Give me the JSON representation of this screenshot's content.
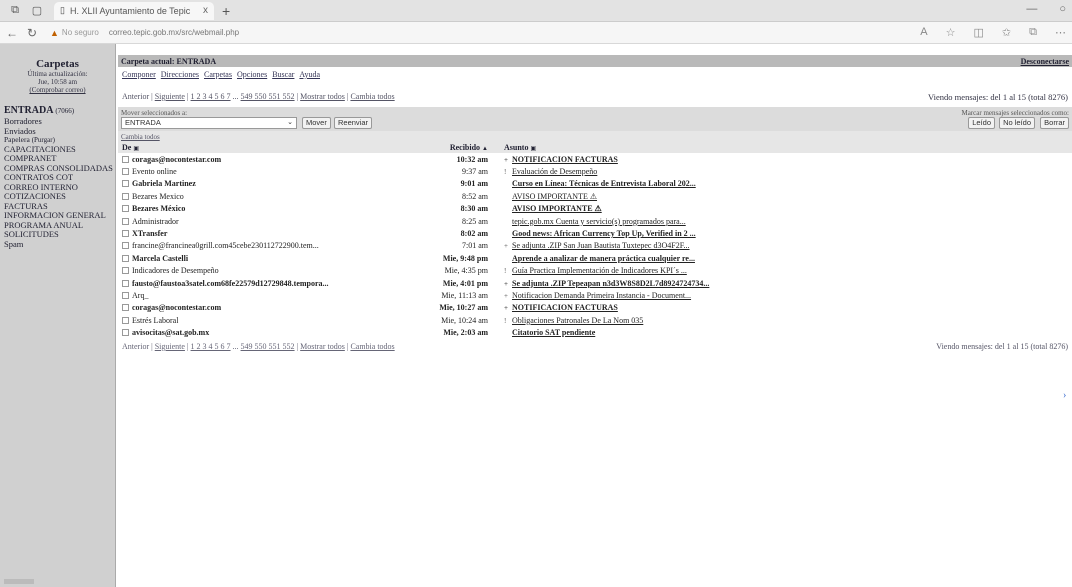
{
  "browser": {
    "tab_title": "H. XLII Ayuntamiento de Tepic",
    "tab_close": "x",
    "new_tab": "+",
    "not_secure": "No seguro",
    "url": "correo.tepic.gob.mx/src/webmail.php"
  },
  "sidebar": {
    "title": "Carpetas",
    "last_update_label": "Última actualización:",
    "last_update_time": "Jue, 10:58 am",
    "check_mail": "(Comprobar correo)",
    "folders": [
      {
        "name": "ENTRADA",
        "count": "(7066)",
        "style": "big"
      },
      {
        "name": "Borradores",
        "count": "",
        "style": ""
      },
      {
        "name": "Enviados",
        "count": "",
        "style": ""
      },
      {
        "name": "Papelera",
        "count": "(Purgar)",
        "style": "small"
      },
      {
        "name": "CAPACITACIONES",
        "count": "",
        "style": ""
      },
      {
        "name": "COMPRANET",
        "count": "",
        "style": ""
      },
      {
        "name": "COMPRAS CONSOLIDADAS",
        "count": "",
        "style": ""
      },
      {
        "name": "CONTRATOS COT",
        "count": "",
        "style": ""
      },
      {
        "name": "CORREO INTERNO",
        "count": "",
        "style": ""
      },
      {
        "name": "COTIZACIONES",
        "count": "",
        "style": ""
      },
      {
        "name": "FACTURAS",
        "count": "",
        "style": ""
      },
      {
        "name": "INFORMACION GENERAL",
        "count": "",
        "style": ""
      },
      {
        "name": "PROGRAMA ANUAL",
        "count": "",
        "style": ""
      },
      {
        "name": "SOLICITUDES",
        "count": "",
        "style": ""
      },
      {
        "name": "Spam",
        "count": "",
        "style": ""
      }
    ]
  },
  "header": {
    "current_folder_label": "Carpeta actual:",
    "current_folder": "ENTRADA",
    "disconnect": "Desconectarse"
  },
  "menu": [
    "Componer",
    "Direcciones",
    "Carpetas",
    "Opciones",
    "Buscar",
    "Ayuda"
  ],
  "pager": {
    "prev": "Anterior",
    "next": "Siguiente",
    "pages": "1 2 3 4 5 6 7",
    "ellipsis": "...",
    "far_pages": "549 550 551 552",
    "show_all": "Mostrar todos",
    "toggle_all": "Cambia todos",
    "viewing": "Viendo mensajes: del 1 al 15 (total 8276)"
  },
  "move": {
    "label": "Mover seleccionados a:",
    "folder": "ENTRADA",
    "move_button": "Mover",
    "forward_button": "Reenviar",
    "mark_label": "Marcar mensajes seleccionados como:",
    "read_button": "Leído",
    "unread_button": "No leído",
    "delete_button": "Borrar",
    "toggle": "Cambia todos"
  },
  "columns": {
    "from": "De",
    "received": "Recibido",
    "subject": "Asunto"
  },
  "messages": [
    {
      "from": "coragas@nocontestar.com",
      "received": "10:32 am",
      "flag": "+",
      "subject": "NOTIFICACION FACTURAS",
      "unread": true
    },
    {
      "from": "Evento online",
      "received": "9:37 am",
      "flag": "!",
      "subject": "Evaluación de Desempeño",
      "unread": false
    },
    {
      "from": "Gabriela Martinez",
      "received": "9:01 am",
      "flag": "",
      "subject": "Curso en Línea: Técnicas de Entrevista Laboral 202...",
      "unread": true
    },
    {
      "from": "Bezares Mexico",
      "received": "8:52 am",
      "flag": "",
      "subject": "AVISO IMPORTANTE ⚠",
      "unread": false
    },
    {
      "from": "Bezares México",
      "received": "8:30 am",
      "flag": "",
      "subject": "AVISO IMPORTANTE ⚠",
      "unread": true
    },
    {
      "from": "Administrador",
      "received": "8:25 am",
      "flag": "",
      "subject": "tepic.gob.mx Cuenta y servicio(s) programados para...",
      "unread": false
    },
    {
      "from": "XTransfer",
      "received": "8:02 am",
      "flag": "",
      "subject": "Good news: African Currency Top Up, Verified in 2 ...",
      "unread": true
    },
    {
      "from": "francine@francinea0grill.com45cebe230112722900.tem...",
      "received": "7:01 am",
      "flag": "+",
      "subject": "Se adjunta .ZIP San Juan Bautista Tuxtepec d3O4F2F...",
      "unread": false
    },
    {
      "from": "Marcela Castelli",
      "received": "Mie, 9:48 pm",
      "flag": "",
      "subject": "Aprende a analizar de manera práctica cualquier re...",
      "unread": true
    },
    {
      "from": "Indicadores de Desempeño",
      "received": "Mie, 4:35 pm",
      "flag": "!",
      "subject": "Guía Practica Implementación de Indicadores KPI´s ...",
      "unread": false
    },
    {
      "from": "fausto@faustoa3satel.com68fe22579d12729848.tempora...",
      "received": "Mie, 4:01 pm",
      "flag": "+",
      "subject": "Se adjunta .ZIP Tepeapan n3d3W8S8D2L7d8924724734...",
      "unread": true
    },
    {
      "from": "Arq_",
      "received": "Mie, 11:13 am",
      "flag": "+",
      "subject": "Notificacion Demanda Primeira Instancia - Document...",
      "unread": false
    },
    {
      "from": "coragas@nocontestar.com",
      "received": "Mie, 10:27 am",
      "flag": "+",
      "subject": "NOTIFICACION FACTURAS",
      "unread": true
    },
    {
      "from": "Estrés Laboral",
      "received": "Mie, 10:24 am",
      "flag": "!",
      "subject": "Obligaciones Patronales De La Nom 035",
      "unread": false
    },
    {
      "from": "avisocitas@sat.gob.mx",
      "received": "Mie, 2:03 am",
      "flag": "",
      "subject": "Citatorio SAT pendiente",
      "unread": true
    }
  ]
}
